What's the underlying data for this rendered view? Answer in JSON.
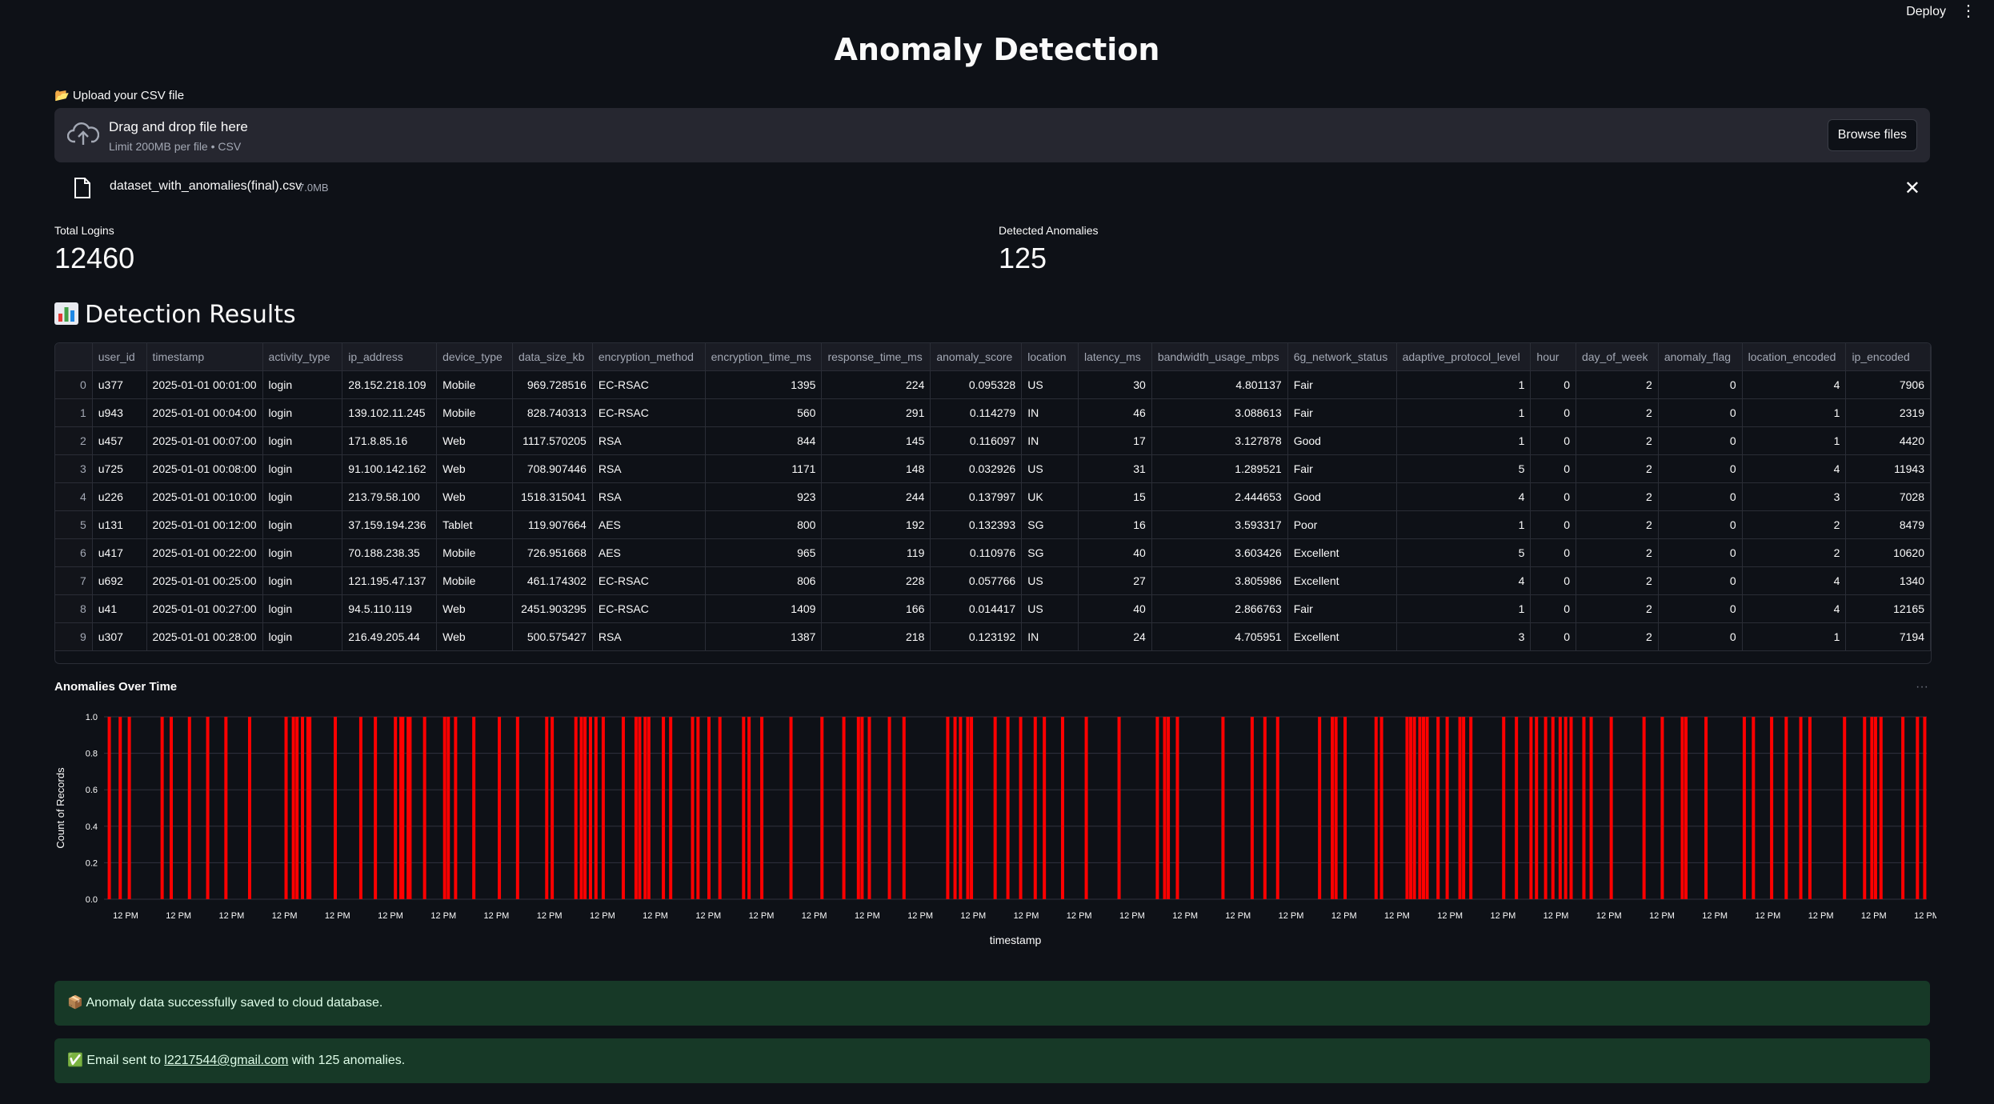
{
  "topbar": {
    "deploy_label": "Deploy",
    "menu_icon": "kebab-menu-icon"
  },
  "page_title": "Anomaly Detection",
  "upload": {
    "label": "📂 Upload your CSV file",
    "drop_title": "Drag and drop file here",
    "drop_subtitle": "Limit 200MB per file • CSV",
    "browse_label": "Browse files",
    "file_name": "dataset_with_anomalies(final).csv",
    "file_size": "7.0MB"
  },
  "metrics": [
    {
      "label": "Total Logins",
      "value": "12460"
    },
    {
      "label": "Detected Anomalies",
      "value": "125"
    }
  ],
  "results_title": "Detection Results",
  "table": {
    "columns": [
      "",
      "user_id",
      "timestamp",
      "activity_type",
      "ip_address",
      "device_type",
      "data_size_kb",
      "encryption_method",
      "encryption_time_ms",
      "response_time_ms",
      "anomaly_score",
      "location",
      "latency_ms",
      "bandwidth_usage_mbps",
      "6g_network_status",
      "adaptive_protocol_level",
      "hour",
      "day_of_week",
      "anomaly_flag",
      "location_encoded",
      "ip_encoded"
    ],
    "rows": [
      [
        "0",
        "u377",
        "2025-01-01 00:01:00",
        "login",
        "28.152.218.109",
        "Mobile",
        "969.728516",
        "EC-RSAC",
        "1395",
        "224",
        "0.095328",
        "US",
        "30",
        "4.801137",
        "Fair",
        "1",
        "0",
        "2",
        "0",
        "4",
        "7906"
      ],
      [
        "1",
        "u943",
        "2025-01-01 00:04:00",
        "login",
        "139.102.11.245",
        "Mobile",
        "828.740313",
        "EC-RSAC",
        "560",
        "291",
        "0.114279",
        "IN",
        "46",
        "3.088613",
        "Fair",
        "1",
        "0",
        "2",
        "0",
        "1",
        "2319"
      ],
      [
        "2",
        "u457",
        "2025-01-01 00:07:00",
        "login",
        "171.8.85.16",
        "Web",
        "1117.570205",
        "RSA",
        "844",
        "145",
        "0.116097",
        "IN",
        "17",
        "3.127878",
        "Good",
        "1",
        "0",
        "2",
        "0",
        "1",
        "4420"
      ],
      [
        "3",
        "u725",
        "2025-01-01 00:08:00",
        "login",
        "91.100.142.162",
        "Web",
        "708.907446",
        "RSA",
        "1171",
        "148",
        "0.032926",
        "US",
        "31",
        "1.289521",
        "Fair",
        "5",
        "0",
        "2",
        "0",
        "4",
        "11943"
      ],
      [
        "4",
        "u226",
        "2025-01-01 00:10:00",
        "login",
        "213.79.58.100",
        "Web",
        "1518.315041",
        "RSA",
        "923",
        "244",
        "0.137997",
        "UK",
        "15",
        "2.444653",
        "Good",
        "4",
        "0",
        "2",
        "0",
        "3",
        "7028"
      ],
      [
        "5",
        "u131",
        "2025-01-01 00:12:00",
        "login",
        "37.159.194.236",
        "Tablet",
        "119.907664",
        "AES",
        "800",
        "192",
        "0.132393",
        "SG",
        "16",
        "3.593317",
        "Poor",
        "1",
        "0",
        "2",
        "0",
        "2",
        "8479"
      ],
      [
        "6",
        "u417",
        "2025-01-01 00:22:00",
        "login",
        "70.188.238.35",
        "Mobile",
        "726.951668",
        "AES",
        "965",
        "119",
        "0.110976",
        "SG",
        "40",
        "3.603426",
        "Excellent",
        "5",
        "0",
        "2",
        "0",
        "2",
        "10620"
      ],
      [
        "7",
        "u692",
        "2025-01-01 00:25:00",
        "login",
        "121.195.47.137",
        "Mobile",
        "461.174302",
        "EC-RSAC",
        "806",
        "228",
        "0.057766",
        "US",
        "27",
        "3.805986",
        "Excellent",
        "4",
        "0",
        "2",
        "0",
        "4",
        "1340"
      ],
      [
        "8",
        "u41",
        "2025-01-01 00:27:00",
        "login",
        "94.5.110.119",
        "Web",
        "2451.903295",
        "EC-RSAC",
        "1409",
        "166",
        "0.014417",
        "US",
        "40",
        "2.866763",
        "Fair",
        "1",
        "0",
        "2",
        "0",
        "4",
        "12165"
      ],
      [
        "9",
        "u307",
        "2025-01-01 00:28:00",
        "login",
        "216.49.205.44",
        "Web",
        "500.575427",
        "RSA",
        "1387",
        "218",
        "0.123192",
        "IN",
        "24",
        "4.705951",
        "Excellent",
        "3",
        "0",
        "2",
        "0",
        "1",
        "7194"
      ]
    ]
  },
  "chart_data": {
    "type": "bar",
    "title": "Anomalies Over Time",
    "xlabel": "timestamp",
    "ylabel": "Count of Records",
    "ylim": [
      0,
      1.0
    ],
    "yticks": [
      "0.0",
      "0.2",
      "0.4",
      "0.6",
      "0.8",
      "1.0"
    ],
    "xticks": [
      "12 PM",
      "12 PM",
      "12 PM",
      "12 PM",
      "12 PM",
      "12 PM",
      "12 PM",
      "12 PM",
      "12 PM",
      "12 PM",
      "12 PM",
      "12 PM",
      "12 PM",
      "12 PM",
      "12 PM",
      "12 PM",
      "12 PM",
      "12 PM",
      "12 PM",
      "12 PM",
      "12 PM",
      "12 PM",
      "12 PM",
      "12 PM",
      "12 PM",
      "12 PM",
      "12 PM",
      "12 PM",
      "12 PM",
      "12 PM",
      "12 PM",
      "12 PM",
      "12 PM",
      "12 PM",
      "12 PM"
    ],
    "bar_color": "#ff0000",
    "grid": true,
    "anomaly_positions": [
      0.2,
      0.8,
      1.3,
      3.1,
      3.6,
      4.6,
      5.6,
      6.6,
      7.9,
      9.9,
      10.3,
      10.5,
      10.8,
      11.1,
      11.2,
      12.6,
      14.0,
      14.8,
      15.9,
      16.2,
      16.3,
      16.6,
      16.7,
      17.5,
      18.6,
      18.8,
      19.2,
      20.2,
      21.6,
      22.6,
      24.2,
      24.5,
      25.8,
      26.1,
      26.3,
      26.6,
      26.9,
      27.3,
      28.4,
      29.1,
      29.3,
      29.6,
      29.8,
      30.6,
      31.0,
      32.2,
      32.5,
      33.1,
      33.7,
      35.0,
      35.3,
      36.0,
      37.6,
      39.3,
      40.5,
      41.3,
      41.5,
      41.9,
      43.0,
      43.8,
      46.2,
      46.6,
      46.9,
      47.3,
      47.5,
      48.8,
      49.5,
      50.2,
      51.0,
      51.5,
      52.5,
      53.8,
      55.6,
      57.7,
      58.1,
      58.3,
      58.8,
      61.3,
      62.9,
      63.6,
      64.3,
      66.6,
      67.3,
      67.5,
      68.0,
      69.7,
      70.0,
      71.4,
      71.6,
      71.8,
      72.1,
      72.3,
      72.5,
      73.1,
      73.6,
      74.3,
      74.5,
      74.9,
      76.7,
      77.4,
      78.2,
      78.5,
      79.0,
      79.4,
      79.8,
      80.1,
      80.4,
      81.1,
      81.5,
      82.6,
      84.4,
      85.4,
      86.5,
      86.7,
      87.8,
      89.9,
      90.4,
      91.4,
      92.2,
      93.0,
      93.5,
      95.4,
      96.5,
      96.9,
      97.1,
      97.4,
      98.6,
      99.4,
      99.8
    ]
  },
  "alerts": {
    "saved": "📦 Anomaly data successfully saved to cloud database.",
    "email_prefix": "✅ Email sent to ",
    "email_address": "l2217544@gmail.com",
    "email_suffix": " with 125 anomalies."
  }
}
